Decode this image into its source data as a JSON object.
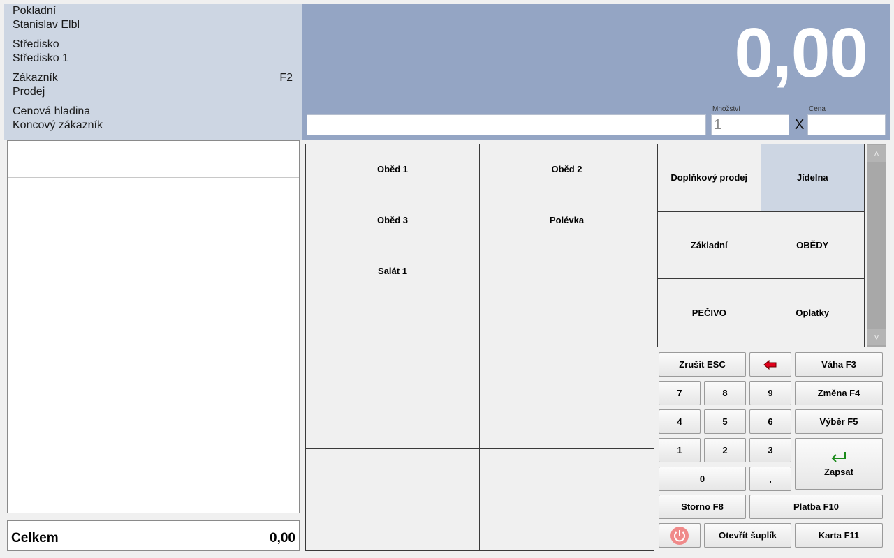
{
  "info": {
    "cashier_label": "Pokladní",
    "cashier_name": "Stanislav Elbl",
    "center_label": "Středisko",
    "center_name": "Středisko 1",
    "customer_label": "Zákazník",
    "customer_key": "F2",
    "customer_value": "Prodej",
    "price_level_label": "Cenová hladina",
    "price_level_value": "Koncový zákazník"
  },
  "display": {
    "total": "0,00",
    "quantity_label": "Množství",
    "quantity_value": "1",
    "multiply_sign": "X",
    "price_label": "Cena"
  },
  "receipt": {
    "total_label": "Celkem",
    "total_value": "0,00"
  },
  "products": [
    "Oběd 1",
    "Oběd 2",
    "Oběd 3",
    "Polévka",
    "Salát 1",
    "",
    "",
    "",
    "",
    "",
    "",
    "",
    "",
    "",
    "",
    ""
  ],
  "categories": [
    {
      "label": "Doplňkový prodej",
      "active": false
    },
    {
      "label": "Jídelna",
      "active": true
    },
    {
      "label": "Základní",
      "active": false
    },
    {
      "label": "OBĚDY",
      "active": false
    },
    {
      "label": "PEČIVO",
      "active": false
    },
    {
      "label": "Oplatky",
      "active": false
    }
  ],
  "keypad": {
    "cancel": "Zrušit ESC",
    "weight": "Váha  F3",
    "change": "Změna F4",
    "select": "Výběr  F5",
    "k7": "7",
    "k8": "8",
    "k9": "9",
    "k4": "4",
    "k5": "5",
    "k6": "6",
    "k1": "1",
    "k2": "2",
    "k3": "3",
    "k0": "0",
    "comma": ",",
    "write": "Zapsat",
    "storno": "Storno F8",
    "payment": "Platba F10",
    "open_drawer": "Otevřít šuplík",
    "card": "Karta F11"
  },
  "colors": {
    "info_bg": "#cdd6e3",
    "display_bg": "#94a5c4",
    "active_category": "#cdd6e3",
    "backspace_arrow": "#e0001b",
    "enter_arrow": "#1a8a1a",
    "power_button": "#f08a8a"
  },
  "icons": {
    "backspace": "backspace-arrow-icon",
    "enter": "enter-arrow-icon",
    "power": "power-icon",
    "scroll_up": "chevron-up-icon",
    "scroll_down": "chevron-down-icon"
  }
}
